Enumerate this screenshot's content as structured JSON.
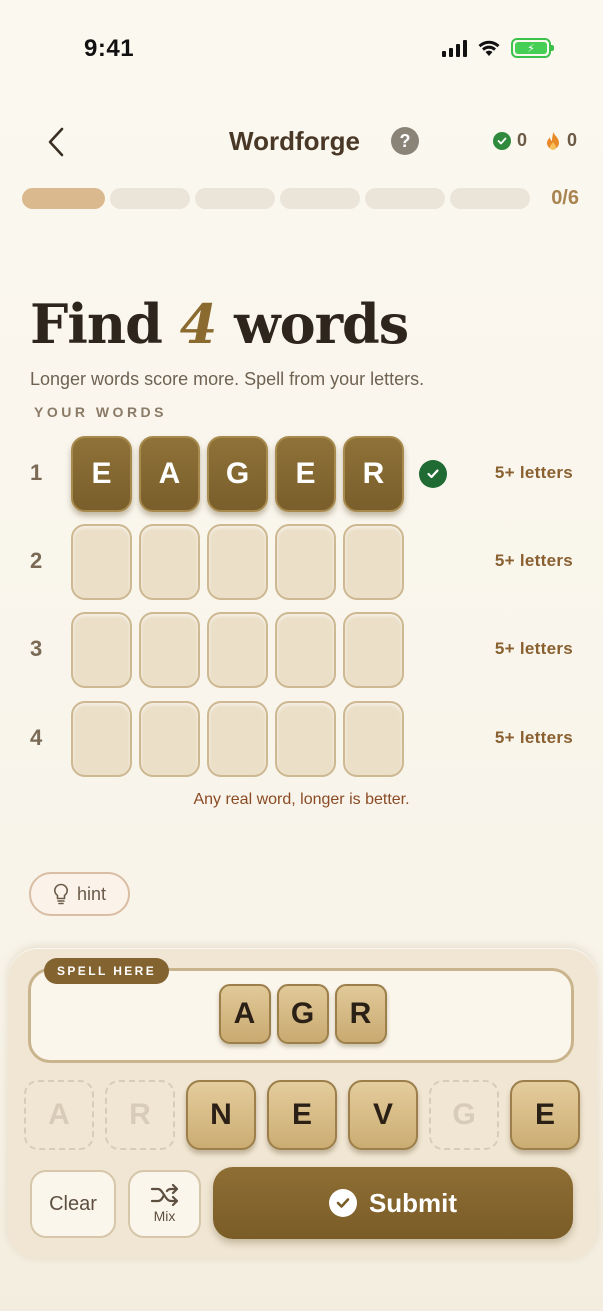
{
  "status": {
    "time": "9:41"
  },
  "nav": {
    "title": "Wordforge",
    "help": "?",
    "correct_count": "0",
    "streak_count": "0"
  },
  "progress": {
    "label": "0/6",
    "segments_total": 6,
    "segments_done": 1
  },
  "heading": {
    "prefix": "Find",
    "number": "4",
    "suffix": "words"
  },
  "subtitle": "Longer words score more. Spell from your letters.",
  "section_label": "YOUR WORDS",
  "rows": [
    {
      "num": "1",
      "letters": [
        "E",
        "A",
        "G",
        "E",
        "R"
      ],
      "solved": true,
      "hint": "5+ letters"
    },
    {
      "num": "2",
      "letters": [
        "",
        "",
        "",
        "",
        ""
      ],
      "solved": false,
      "hint": "5+ letters"
    },
    {
      "num": "3",
      "letters": [
        "",
        "",
        "",
        "",
        ""
      ],
      "solved": false,
      "hint": "5+ letters"
    },
    {
      "num": "4",
      "letters": [
        "",
        "",
        "",
        "",
        ""
      ],
      "solved": false,
      "hint": "5+ letters"
    }
  ],
  "rule": "Any real word, longer is better.",
  "hint_button": "hint",
  "spell": {
    "tag": "SPELL HERE",
    "letters": [
      "A",
      "G",
      "R"
    ]
  },
  "letter_bank": [
    {
      "letter": "A",
      "used": true
    },
    {
      "letter": "R",
      "used": true
    },
    {
      "letter": "N",
      "used": false
    },
    {
      "letter": "E",
      "used": false
    },
    {
      "letter": "V",
      "used": false
    },
    {
      "letter": "G",
      "used": true
    },
    {
      "letter": "E",
      "used": false
    }
  ],
  "actions": {
    "clear": "Clear",
    "mix": "Mix",
    "submit": "Submit"
  },
  "colors": {
    "accent": "#7a5e2b",
    "success": "#1f6b33",
    "background": "#fbf8f0"
  }
}
